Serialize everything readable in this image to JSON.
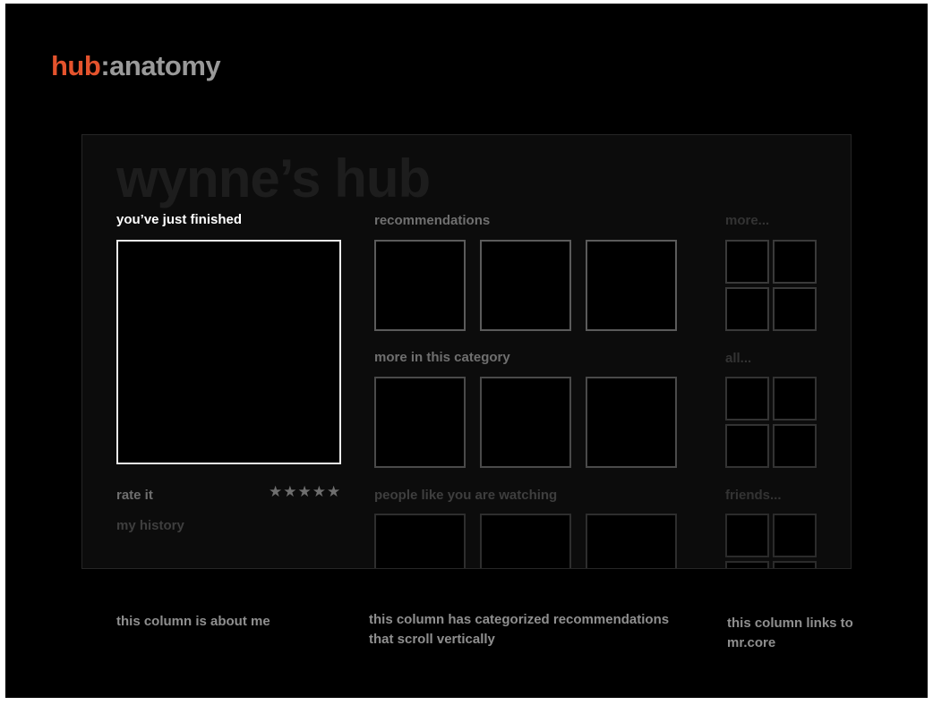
{
  "brand": {
    "accent": "hub",
    "rest": ":anatomy",
    "accent_color": "#e4532d"
  },
  "hub": {
    "title": "wynne’s hub",
    "left_column": {
      "heading": "you’ve just finished",
      "rate_label": "rate it",
      "stars": "★★★★★",
      "history_label": "my history"
    },
    "sections": [
      {
        "heading": "recommendations",
        "side_link": "more..."
      },
      {
        "heading": "more in this category",
        "side_link": "all..."
      },
      {
        "heading": "people like you are watching",
        "side_link": "friends..."
      }
    ]
  },
  "captions": {
    "left": "this column is about me",
    "middle": "this column has categorized recommendations that scroll vertically",
    "right": "this column links to mr.core"
  }
}
